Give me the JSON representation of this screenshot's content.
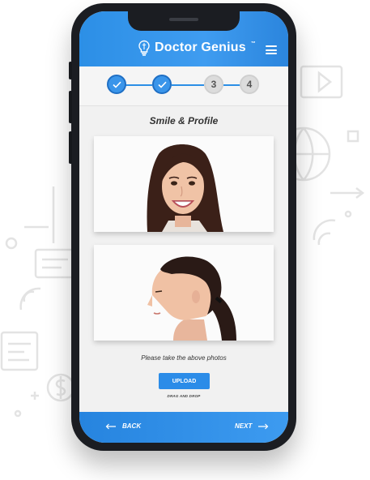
{
  "app": {
    "brand_name": "Doctor Genius",
    "brand_tm": "™"
  },
  "steps": [
    {
      "label": "1",
      "status": "done"
    },
    {
      "label": "2",
      "status": "done"
    },
    {
      "label": "3",
      "status": "todo"
    },
    {
      "label": "4",
      "status": "todo"
    }
  ],
  "page": {
    "title": "Smile & Profile",
    "caption": "Please take the above photos",
    "upload_label": "UPLOAD",
    "drag_drop_label": "DRAG AND DROP"
  },
  "nav": {
    "back_label": "BACK",
    "next_label": "NEXT"
  },
  "icons": {
    "menu": "hamburger-menu-icon",
    "check": "check-icon",
    "back": "arrow-left-icon",
    "next": "arrow-right-icon"
  },
  "colors": {
    "primary": "#2c8fe6",
    "step_done": "#3a95ea",
    "step_todo": "#dcdcdc"
  }
}
